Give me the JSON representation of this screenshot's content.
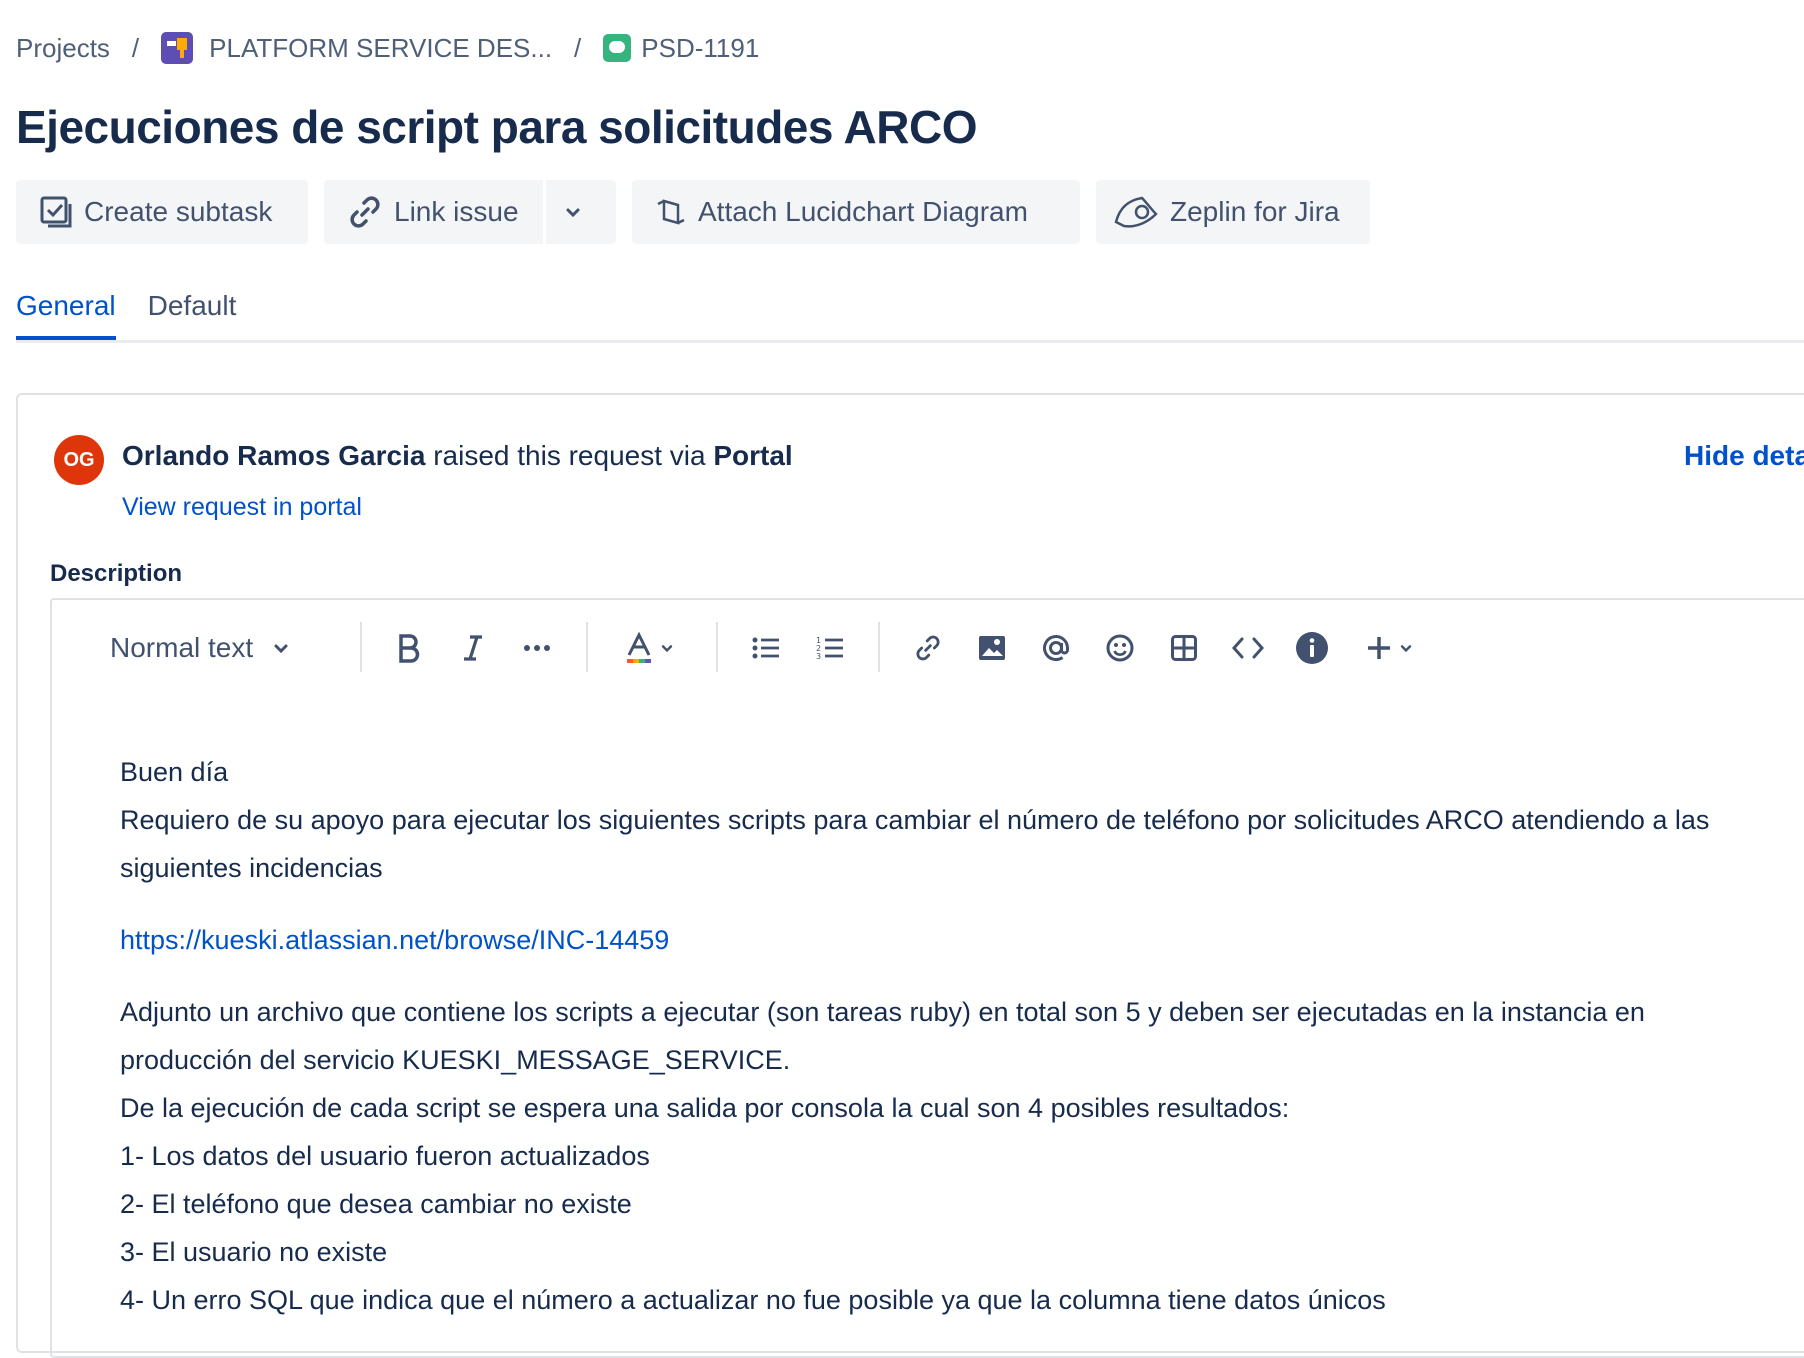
{
  "breadcrumb": {
    "projects": "Projects",
    "separator": "/",
    "project": "PLATFORM SERVICE DES...",
    "issue_key": "PSD-1191"
  },
  "issue": {
    "title": "Ejecuciones de script para solicitudes ARCO"
  },
  "actions": {
    "create_subtask": "Create subtask",
    "link_issue": "Link issue",
    "attach_lucidchart": "Attach Lucidchart Diagram",
    "zeplin": "Zeplin for Jira"
  },
  "tabs": [
    {
      "label": "General",
      "active": true
    },
    {
      "label": "Default",
      "active": false
    }
  ],
  "request": {
    "avatar_initials": "OG",
    "reporter": "Orlando Ramos Garcia",
    "raised_text": " raised this request via ",
    "channel": "Portal",
    "view_link": "View request in portal",
    "hide_link": "Hide details"
  },
  "description": {
    "label": "Description",
    "toolbar": {
      "text_style": "Normal text"
    },
    "lines": {
      "greeting": "Buen día",
      "request": "Requiero de su apoyo para ejecutar los siguientes scripts para cambiar el número de teléfono por solicitudes ARCO atendiendo a las siguientes incidencias",
      "link": "https://kueski.atlassian.net/browse/INC-14459",
      "attach": "Adjunto un archivo que contiene los scripts a ejecutar (son tareas ruby) en total  son 5 y deben ser ejecutadas en la instancia en producción del servicio KUESKI_MESSAGE_SERVICE.",
      "expect": "De la ejecución de cada script se espera una salida por consola la cual son 4 posibles resultados:",
      "r1": "1- Los datos del usuario fueron actualizados",
      "r2": "2- El teléfono que desea cambiar no existe",
      "r3": "3- El usuario no existe",
      "r4": "4- Un erro SQL que indica que el número a actualizar no fue posible ya que la columna tiene datos únicos"
    }
  },
  "colors": {
    "accent": "#0052cc",
    "text": "#172b4d",
    "muted": "#42526e",
    "avatar": "#de350b",
    "project_icon": "#5e4db2",
    "issue_icon": "#36b37e"
  }
}
